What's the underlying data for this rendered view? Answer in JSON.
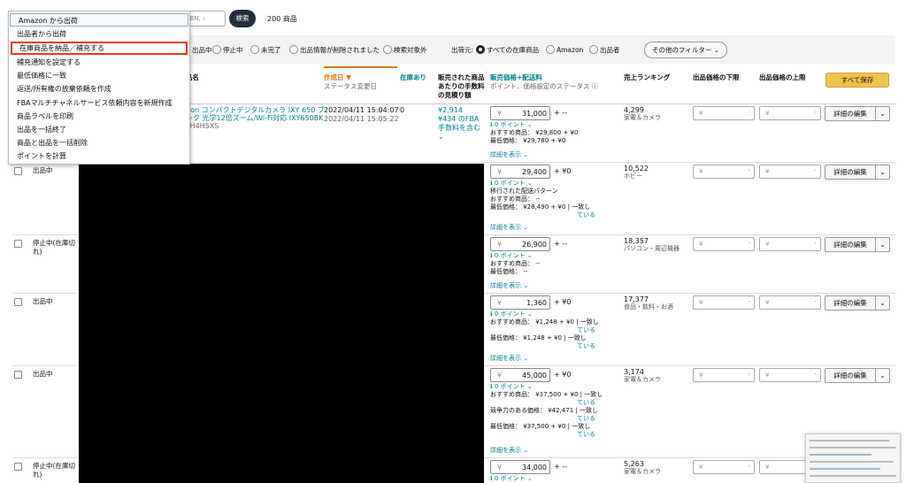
{
  "search": {
    "placeholder": "ISBN, ›",
    "button": "検索",
    "count": "200 商品"
  },
  "filters": {
    "listing_status": [
      "出品中",
      "停止中",
      "未完了",
      "出品情報が削除されました",
      "検索対象外"
    ],
    "fulfillment_label": "出荷元:",
    "fulfillment_options": [
      "すべての在庫商品",
      "Amazon",
      "出品者"
    ],
    "other_filter": "その他のフィルター"
  },
  "header": {
    "product_name": "品名",
    "product_sub": "N",
    "created": "作成日 ▼",
    "created_sub": "ステータス変更日",
    "in_stock": "在庫あり",
    "fee": "販売された商品あたりの手数料の見積り額",
    "price": "販売価格+配送料",
    "price_sub": "ポイント、価格設定のステータス",
    "ranking": "売上ランキング",
    "min_price": "出品価格の下限",
    "max_price": "出品価格の上限",
    "save_all": "すべて保存"
  },
  "row1": {
    "title_l1": "non コンパクトデジタルカメラ IXY 650 ブ",
    "title_l2": "ック 光学12倍ズーム/Wi-Fi対応 IXY650BK",
    "asin": "FH4H5XS",
    "created": "2022/04/11 15:04:07",
    "status_date": "2022/04/11 15:05:22",
    "stock": "0",
    "fee_l1": "¥2,914",
    "fee_l2": "¥434 のFBA",
    "fee_l3": "手数料を含む"
  },
  "common": {
    "yen": "¥",
    "detail": "詳細を表示 ⌄",
    "edit": "詳細の編集",
    "point_prefix": "ℹ︎ 0 ポイント ⌄"
  },
  "rows": [
    {
      "status": "",
      "price": "31,000",
      "plus": "+ --",
      "lines": [
        "おすすめ商品： ¥29,800 + ¥0",
        "最低価格： ¥29,780 + ¥0"
      ],
      "rank": "4,299",
      "cat": "家電＆カメラ"
    },
    {
      "status": "出品中",
      "price": "29,400",
      "plus": "+ ¥0",
      "lines": [
        "移行された配送パターン",
        "おすすめ商品： --",
        "最低価格： ¥28,490 + ¥0 | 一致し",
        "ている"
      ],
      "rank": "10,522",
      "cat": "ホビー"
    },
    {
      "status": "停止中(在庫切れ)",
      "price": "26,900",
      "plus": "+ --",
      "lines": [
        "おすすめ商品： --",
        "最低価格： --"
      ],
      "rank": "18,357",
      "cat": "パソコン・周辺機器"
    },
    {
      "status": "出品中",
      "price": "1,360",
      "plus": "+ ¥0",
      "lines": [
        "おすすめ商品： ¥1,248 + ¥0 | 一致し",
        "ている",
        "最低価格： ¥1,248 + ¥0 | 一致し",
        "ている"
      ],
      "rank": "17,377",
      "cat": "食品・飲料・お酒"
    },
    {
      "status": "出品中",
      "price": "45,000",
      "plus": "+ ¥0",
      "lines": [
        "おすすめ商品： ¥37,500 + ¥0 | 一致し",
        "ている",
        "競争力のある価格： ¥42,471 | 一致し",
        "ている",
        "最低価格： ¥37,500 + ¥0 | 一致し",
        "ている"
      ],
      "rank": "3,174",
      "cat": "家電＆カメラ"
    },
    {
      "status": "停止中(在庫切れ)",
      "price": "34,000",
      "plus": "+ --",
      "lines": [],
      "rank": "5,263",
      "cat": "家電＆カメラ"
    }
  ],
  "menu": [
    "Amazon から出荷",
    "出品者から出荷",
    "在庫商品を納品／補充する",
    "補充通知を設定する",
    "最低価格に一致",
    "返送/所有権の放棄依頼を作成",
    "FBAマルチチャネルサービス依頼内容を新規作成",
    "商品ラベルを印刷",
    "出品を一括終了",
    "商品と出品を一括削除",
    "ポイントを計算"
  ]
}
